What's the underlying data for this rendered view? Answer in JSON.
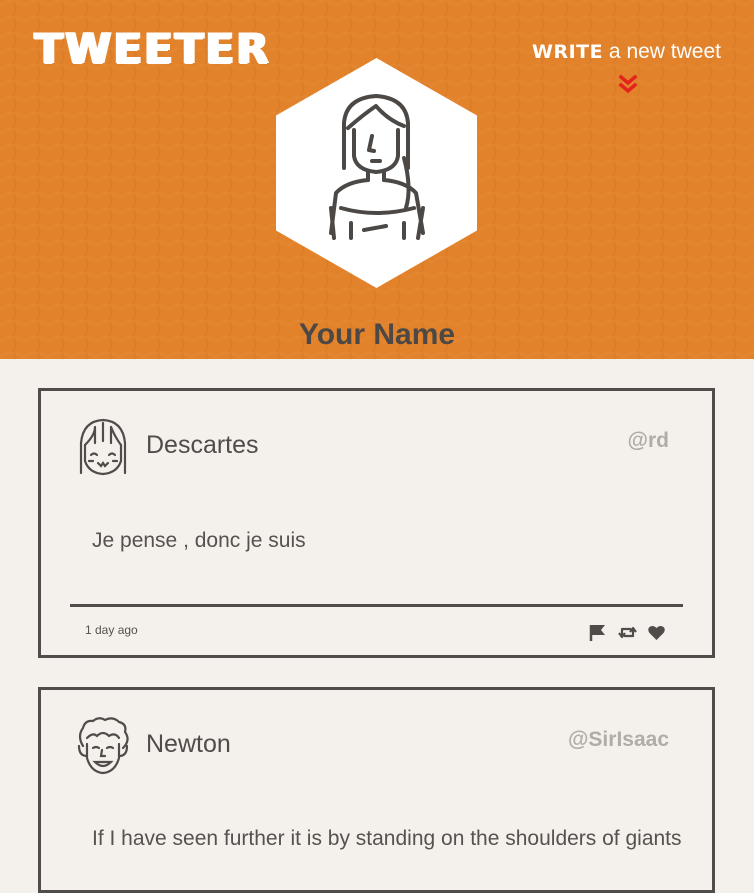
{
  "header": {
    "logo": "TWEETER",
    "write_strong": "WRITE",
    "write_rest": " a new tweet",
    "accent_color": "#e2822a",
    "chevron_color": "#e4231c",
    "user_name": "Your Name"
  },
  "tweets": [
    {
      "name": "Descartes",
      "handle": "@rd",
      "text": "Je pense , donc je suis",
      "time": "1 day ago",
      "actions": [
        "flag-icon",
        "retweet-icon",
        "heart-icon"
      ]
    },
    {
      "name": "Newton",
      "handle": "@SirIsaac",
      "text": "If I have seen further it is by standing on the shoulders of giants"
    }
  ]
}
